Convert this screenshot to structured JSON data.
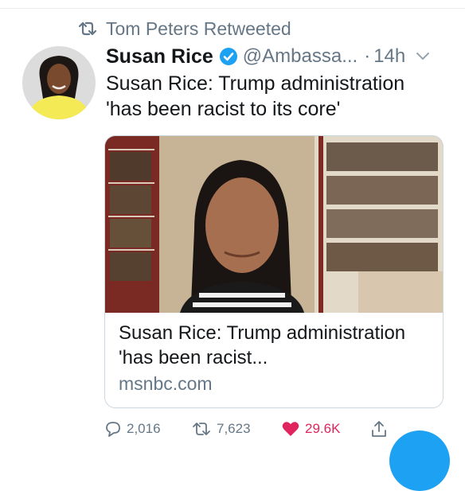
{
  "social_context": {
    "text": "Tom Peters Retweeted"
  },
  "author": {
    "name": "Susan Rice",
    "handle": "@Ambassa...",
    "separator": "·",
    "time": "14h"
  },
  "tweet": {
    "text": "Susan Rice: Trump administration 'has been racist to its core'"
  },
  "card": {
    "title": "Susan Rice: Trump administration 'has been racist...",
    "domain": "msnbc.com"
  },
  "actions": {
    "replies": "2,016",
    "retweets": "7,623",
    "likes": "29.6K"
  },
  "colors": {
    "accent": "#1da1f2",
    "like": "#e0245e",
    "muted": "#657786",
    "text": "#14171a"
  },
  "icons": [
    "retweet-icon",
    "verified-badge-icon",
    "chevron-down-icon",
    "reply-icon",
    "retweet-icon",
    "heart-icon",
    "share-icon",
    "compose-icon"
  ]
}
